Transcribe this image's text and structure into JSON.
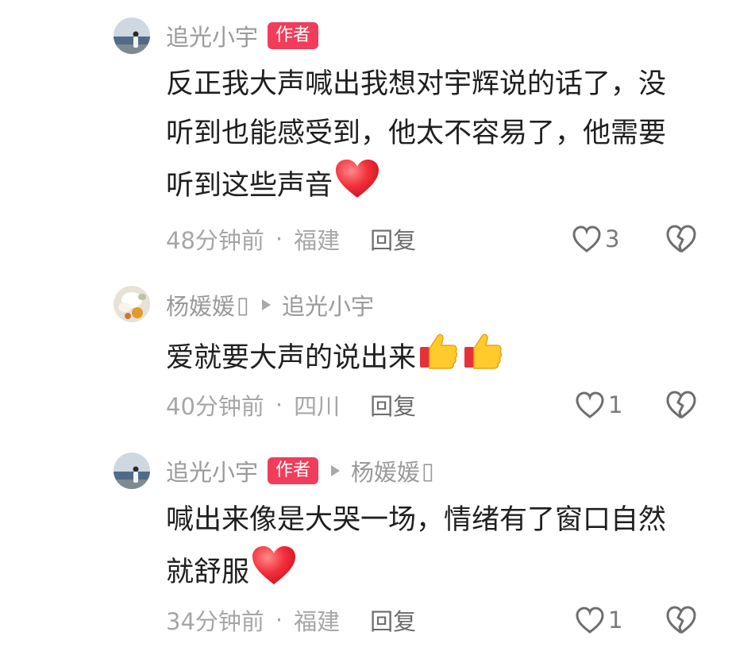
{
  "comments": [
    {
      "username": "追光小宇",
      "author_badge": "作者",
      "reply_to": "",
      "text": "反正我大声喊出我想对宇辉说的话了，没听到也能感受到，他太不容易了，他需要听到这些声音",
      "emoji": "red-heart",
      "time": "48分钟前",
      "location": "福建",
      "reply_label": "回复",
      "likes": "3",
      "avatar_icon": "beach-person-avatar"
    },
    {
      "username": "杨媛媛",
      "author_badge": "",
      "reply_to": "追光小宇",
      "text": "爱就要大声的说出来",
      "emoji": "thumbs-up-x2",
      "time": "40分钟前",
      "location": "四川",
      "reply_label": "回复",
      "likes": "1",
      "avatar_icon": "flower-avatar"
    },
    {
      "username": "追光小宇",
      "author_badge": "作者",
      "reply_to": "杨媛媛",
      "text": "喊出来像是大哭一场，情绪有了窗口自然就舒服",
      "emoji": "red-heart",
      "time": "34分钟前",
      "location": "福建",
      "reply_label": "回复",
      "likes": "1",
      "avatar_icon": "beach-person-avatar"
    }
  ],
  "colors": {
    "badge": "#f13c5b",
    "meta_text": "#a6a6a6",
    "body_text": "#1f1f1f"
  }
}
